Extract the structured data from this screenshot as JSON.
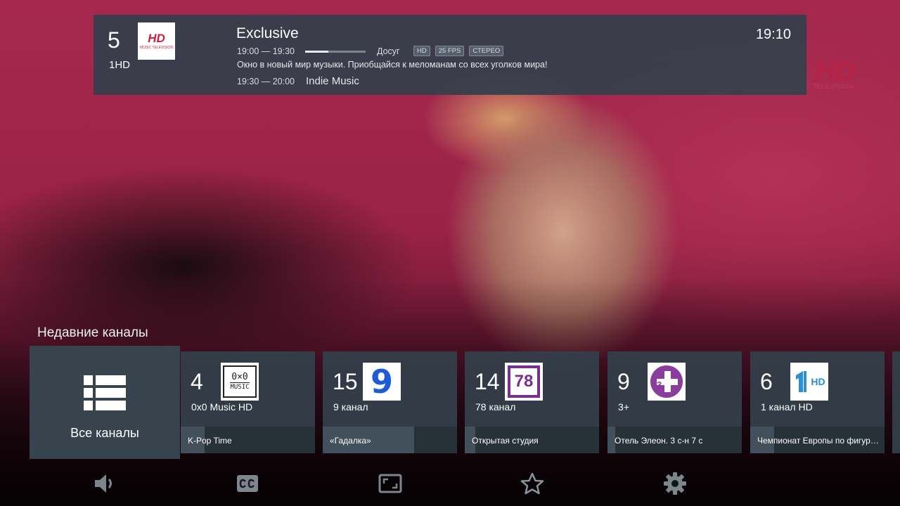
{
  "background": {
    "watermark_text": "HD",
    "watermark_sub": "MUSIC TELEVISION"
  },
  "info_bar": {
    "channel_number": "5",
    "channel_name": "1HD",
    "channel_logo_text": "HD",
    "channel_logo_sub": "MUSIC TELEVISION",
    "program_title": "Exclusive",
    "program_time": "19:00 — 19:30",
    "progress": 0.38,
    "genre": "Досуг",
    "badges": [
      "HD",
      "25 FPS",
      "СТЕРЕО"
    ],
    "description": "Окно в новый мир музыки. Приобщайся к меломанам со всех уголков мира!",
    "next_time": "19:30 — 20:00",
    "next_title": "Indie Music",
    "clock": "19:10"
  },
  "recent": {
    "heading": "Недавние каналы",
    "all_channels_label": "Все каналы",
    "channels": [
      {
        "number": "4",
        "name": "0x0 Music HD",
        "logo": "0x0-music-logo",
        "program": "K-Pop Time",
        "progress": 0.18
      },
      {
        "number": "15",
        "name": "9 канал",
        "logo": "9-kanal-logo",
        "program": "«Гадалка»",
        "progress": 0.68
      },
      {
        "number": "14",
        "name": "78 канал",
        "logo": "78-kanal-logo",
        "program": "Открытая студия",
        "progress": 0.08
      },
      {
        "number": "9",
        "name": "3+",
        "logo": "3plus-logo",
        "program": "Отель Элеон. 3 с-н 7 с",
        "progress": 0.06
      },
      {
        "number": "6",
        "name": "1 канал HD",
        "logo": "1kanal-hd-logo",
        "program": "Чемпионат Европы по фигурному катанию",
        "progress": 0.18
      }
    ],
    "logo_texts": {
      "oxo_top": "0×0",
      "oxo_bottom": "MUSIC",
      "nine": "9",
      "seventy_eight": "78",
      "three_plus": "3",
      "one_hd": "HD"
    }
  },
  "controls": [
    "volume-icon",
    "subtitles-icon",
    "aspect-ratio-icon",
    "favorite-star-icon",
    "settings-gear-icon"
  ],
  "colors": {
    "panel": "#34404a",
    "accent_red": "#d11f3f",
    "nine_blue": "#1e5bd6",
    "seventy_eight_purple": "#7a2f8e",
    "three_plus_purple": "#8a3d9c",
    "one_hd_blue": "#2d8fd0"
  }
}
